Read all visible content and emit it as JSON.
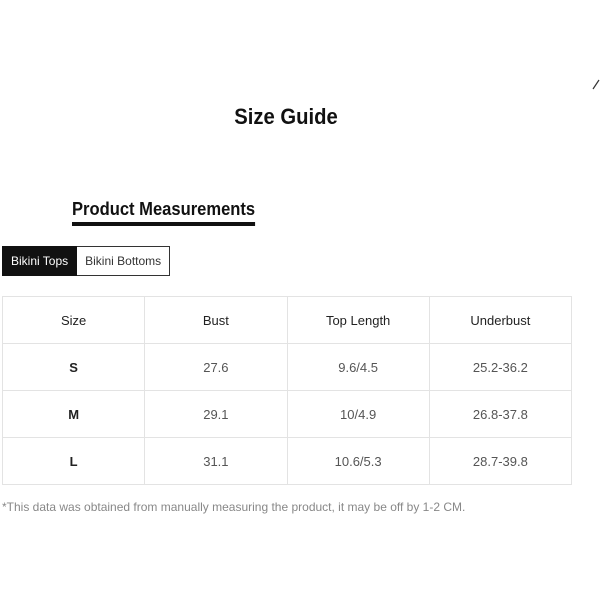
{
  "header": {
    "title": "Size Guide"
  },
  "section": {
    "title": "Product Measurements"
  },
  "tabs": [
    {
      "label": "Bikini Tops",
      "active": true
    },
    {
      "label": "Bikini Bottoms",
      "active": false
    }
  ],
  "table": {
    "columns": [
      "Size",
      "Bust",
      "Top Length",
      "Underbust"
    ],
    "rows": [
      {
        "size": "S",
        "bust": "27.6",
        "top_length": "9.6/4.5",
        "underbust": "25.2-36.2"
      },
      {
        "size": "M",
        "bust": "29.1",
        "top_length": "10/4.9",
        "underbust": "26.8-37.8"
      },
      {
        "size": "L",
        "bust": "31.1",
        "top_length": "10.6/5.3",
        "underbust": "28.7-39.8"
      }
    ]
  },
  "note": "*This data was obtained from manually measuring the product, it may be off by 1-2 CM.",
  "colors": {
    "active_tab_bg": "#111111",
    "table_border": "#e3e3e3",
    "note_text": "#888888"
  }
}
